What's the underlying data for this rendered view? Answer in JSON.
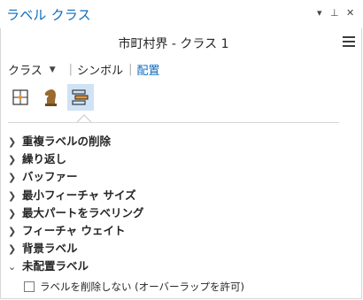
{
  "pane": {
    "title": "ラベル クラス",
    "controls": {
      "menu": "▾",
      "pin": "⊥",
      "close": "✕"
    }
  },
  "header": {
    "class_name": "市町村界 - クラス 1"
  },
  "tabs": {
    "class": "クラス",
    "symbol": "シンボル",
    "placement": "配置",
    "active": "placement"
  },
  "icon_buttons": [
    {
      "icon": "position-icon",
      "selected": false
    },
    {
      "icon": "chess-knight-icon",
      "selected": false
    },
    {
      "icon": "label-placement-icon",
      "selected": true
    }
  ],
  "sections": [
    {
      "label": "重複ラベルの削除",
      "expanded": false
    },
    {
      "label": "繰り返し",
      "expanded": false
    },
    {
      "label": "バッファー",
      "expanded": false
    },
    {
      "label": "最小フィーチャ サイズ",
      "expanded": false
    },
    {
      "label": "最大パートをラベリング",
      "expanded": false
    },
    {
      "label": "フィーチャ ウェイト",
      "expanded": false
    },
    {
      "label": "背景ラベル",
      "expanded": false
    },
    {
      "label": "未配置ラベル",
      "expanded": true
    }
  ],
  "unplaced": {
    "checkbox_label": "ラベルを削除しない (オーバーラップを許可)",
    "checked": false
  },
  "colors": {
    "accent": "#0f6cbd",
    "selected_bg": "#cfe3f5"
  }
}
